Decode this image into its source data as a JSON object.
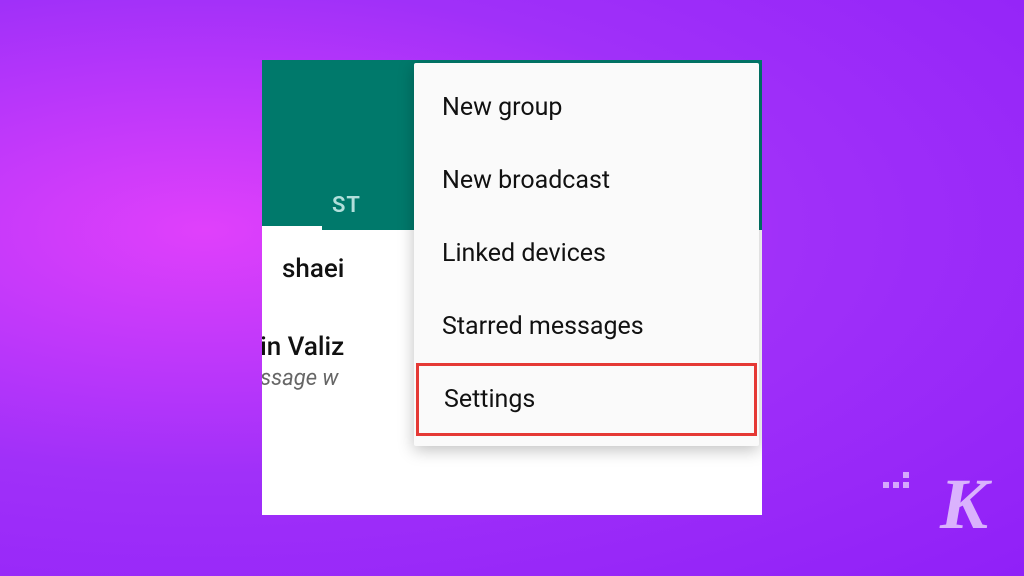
{
  "header": {
    "tab_partial": "ST"
  },
  "chats": {
    "item1_name_partial": "shaei",
    "item2_name_partial": "erin Valiz",
    "item2_preview_partial": "nessage w"
  },
  "menu": {
    "new_group": "New group",
    "new_broadcast": "New broadcast",
    "linked_devices": "Linked devices",
    "starred_messages": "Starred messages",
    "settings": "Settings"
  },
  "watermark": "K"
}
